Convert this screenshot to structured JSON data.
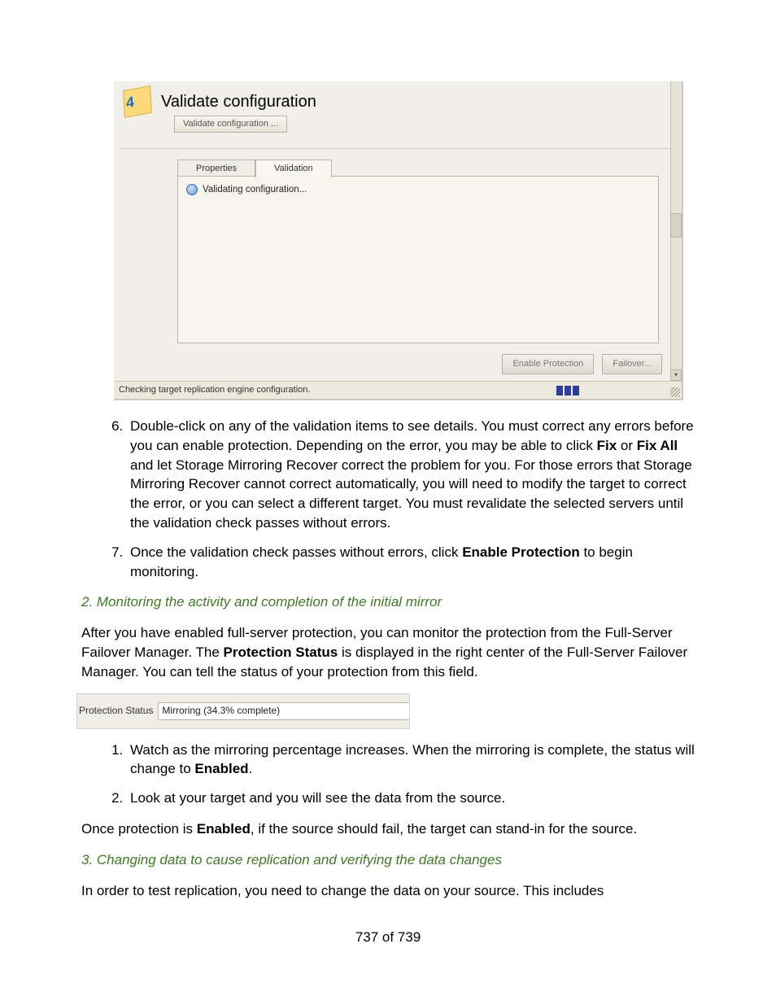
{
  "shot1": {
    "step_number": "4",
    "title": "Validate configuration",
    "header_button": "Validate configuration ...",
    "tab_properties": "Properties",
    "tab_validation": "Validation",
    "validating_text": "Validating configuration...",
    "btn_enable": "Enable Protection",
    "btn_failover": "Failover...",
    "status_text": "Checking target replication engine configuration."
  },
  "list1": {
    "start": 6,
    "items": [
      "Double-click on any of the validation items to see details. You must correct any errors before you can enable protection. Depending on the error, you may be able to click <b>Fix</b> or <b>Fix All</b> and let Storage Mirroring Recover correct the problem for you. For those errors that Storage Mirroring Recover cannot correct automatically, you will need to modify the target to correct the error, or you can select a different target. You must revalidate the selected servers until the validation check passes without errors.",
      "Once the validation check passes without errors, click <b>Enable Protection</b> to begin monitoring."
    ]
  },
  "subhead1": "2. Monitoring the activity and completion of the initial mirror",
  "para1": "After you have enabled full-server protection, you can monitor the protection from the Full-Server Failover Manager. The <b>Protection Status</b> is displayed in the right center of the Full-Server Failover Manager. You can tell the status of your protection from this field.",
  "shot2": {
    "label": "Protection Status",
    "value": "Mirroring (34.3% complete)"
  },
  "list2": {
    "start": 1,
    "items": [
      "Watch as the mirroring percentage increases. When the mirroring is complete, the status will change to <b>Enabled</b>.",
      "Look at your target and you will see the data from the source."
    ]
  },
  "para2": "Once protection is <b>Enabled</b>, if the source should fail, the target can stand-in for the source.",
  "subhead2": "3. Changing data to cause replication and verifying the data changes",
  "para3": "In order to test replication, you need to change the data on your source. This includes",
  "pagenum": "737 of 739"
}
